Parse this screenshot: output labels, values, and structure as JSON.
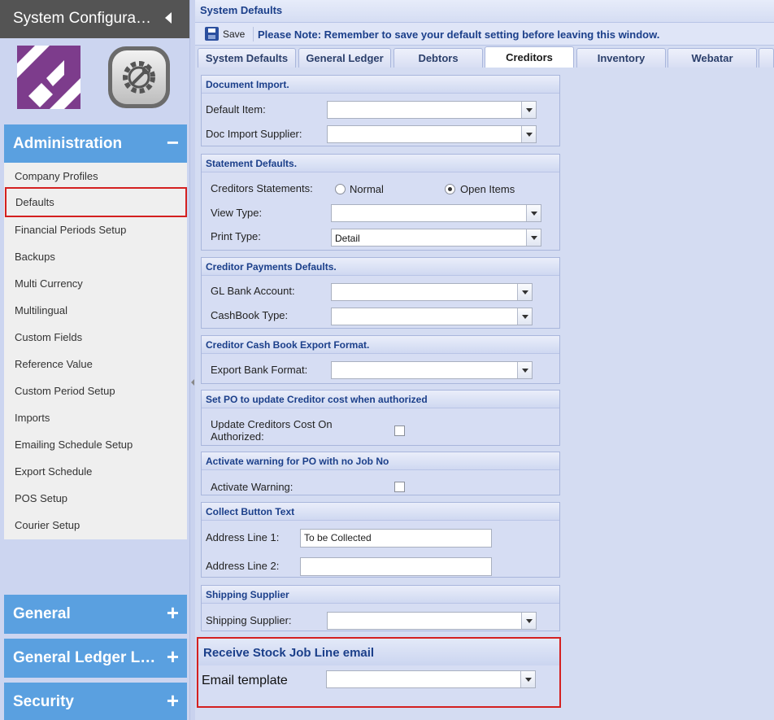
{
  "sidebar": {
    "title": "System Configuration",
    "sections": [
      {
        "label": "Administration",
        "toggle": "−"
      },
      {
        "label": "General",
        "toggle": "+"
      },
      {
        "label": "General Ledger Links",
        "toggle": "+"
      },
      {
        "label": "Security",
        "toggle": "+"
      }
    ],
    "admin_items": [
      "Company Profiles",
      "Defaults",
      "Financial Periods Setup",
      "Backups",
      "Multi Currency",
      "Multilingual",
      "Custom Fields",
      "Reference Value",
      "Custom Period Setup",
      "Imports",
      "Emailing Schedule Setup",
      "Export Schedule",
      "POS Setup",
      "Courier Setup"
    ]
  },
  "main": {
    "title": "System Defaults",
    "save_label": "Save",
    "note": "Please Note: Remember to save your default setting before leaving this window.",
    "tabs": [
      "System Defaults",
      "General Ledger",
      "Debtors",
      "Creditors",
      "Inventory",
      "Webatar"
    ],
    "active_tab": "Creditors"
  },
  "panels": {
    "doc_import": {
      "title": "Document Import.",
      "default_item_label": "Default Item:",
      "default_item_value": "",
      "supplier_label": "Doc Import Supplier:",
      "supplier_value": ""
    },
    "statement": {
      "title": "Statement Defaults.",
      "creditors_statements_label": "Creditors Statements:",
      "option_normal": "Normal",
      "option_open_items": "Open Items",
      "selected": "Open Items",
      "view_type_label": "View Type:",
      "view_type_value": "",
      "print_type_label": "Print Type:",
      "print_type_value": "Detail"
    },
    "payments": {
      "title": "Creditor Payments Defaults.",
      "gl_bank_label": "GL Bank Account:",
      "gl_bank_value": "",
      "cashbook_label": "CashBook Type:",
      "cashbook_value": ""
    },
    "cashbook_export": {
      "title": "Creditor Cash Book Export Format.",
      "export_label": "Export Bank Format:",
      "export_value": ""
    },
    "po_cost": {
      "title": "Set PO to update Creditor cost when authorized",
      "label_line1": "Update Creditors Cost On",
      "label_line2": "Authorized:",
      "checked": false
    },
    "po_warning": {
      "title": "Activate warning for PO with no Job No",
      "label": "Activate Warning:",
      "checked": false
    },
    "collect": {
      "title": "Collect Button Text",
      "line1_label": "Address Line 1:",
      "line1_value": "To be Collected",
      "line2_label": "Address Line 2:",
      "line2_value": ""
    },
    "shipping": {
      "title": "Shipping Supplier",
      "label": "Shipping Supplier:",
      "value": ""
    },
    "receive_stock": {
      "title": "Receive Stock Job Line email",
      "label": "Email template",
      "value": ""
    }
  },
  "colors": {
    "accordion": "#5aa0e0",
    "highlight": "#d42020",
    "panel_title": "#1b3f8a",
    "logo": "#7d3c8c"
  }
}
